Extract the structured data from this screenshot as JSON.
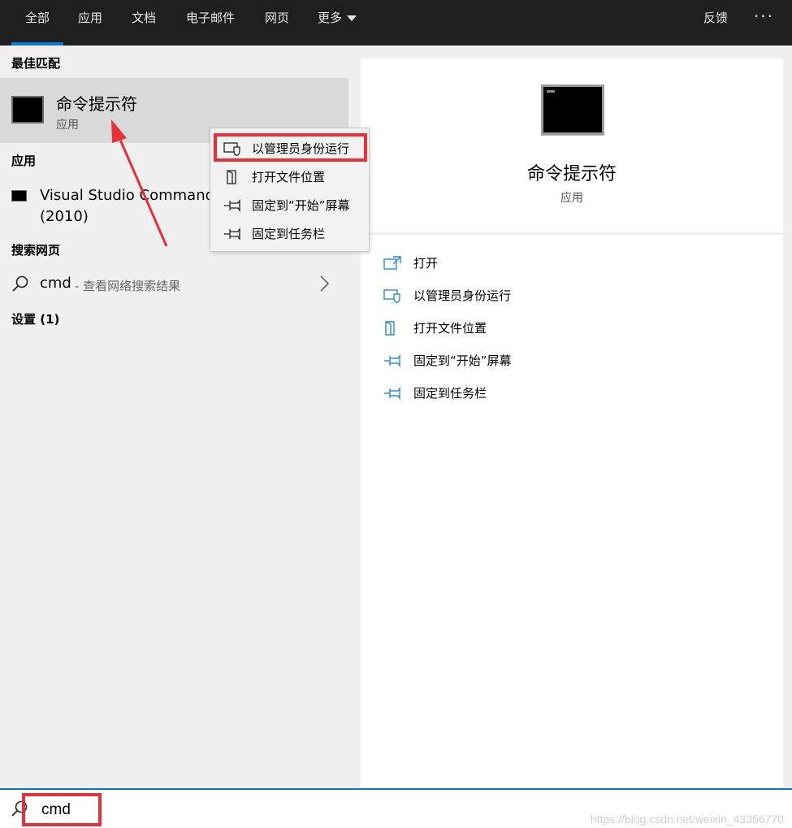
{
  "topbar": {
    "tabs": [
      {
        "label": "全部"
      },
      {
        "label": "应用"
      },
      {
        "label": "文档"
      },
      {
        "label": "电子邮件"
      },
      {
        "label": "网页"
      },
      {
        "label": "更多"
      }
    ],
    "feedback_label": "反馈",
    "more_options_label": "···"
  },
  "left": {
    "best_match_heading": "最佳匹配",
    "best_match": {
      "title": "命令提示符",
      "subtitle": "应用"
    },
    "apps_heading": "应用",
    "apps": [
      {
        "label": "Visual Studio Command\n(2010)"
      }
    ],
    "web_heading": "搜索网页",
    "web_result": {
      "query": "cmd",
      "hint": "- 查看网络搜索结果"
    },
    "settings_heading": "设置 (1)"
  },
  "context_menu": {
    "items": [
      {
        "label": "以管理员身份运行",
        "icon": "shield-icon"
      },
      {
        "label": "打开文件位置",
        "icon": "folder-icon"
      },
      {
        "label": "固定到“开始”屏幕",
        "icon": "pin-icon"
      },
      {
        "label": "固定到任务栏",
        "icon": "pin-icon"
      }
    ]
  },
  "preview": {
    "title": "命令提示符",
    "subtitle": "应用",
    "actions": [
      {
        "label": "打开",
        "icon": "open-icon"
      },
      {
        "label": "以管理员身份运行",
        "icon": "shield-icon"
      },
      {
        "label": "打开文件位置",
        "icon": "folder-icon"
      },
      {
        "label": "固定到“开始”屏幕",
        "icon": "pin-icon"
      },
      {
        "label": "固定到任务栏",
        "icon": "pin-icon"
      }
    ]
  },
  "search": {
    "value": "cmd"
  },
  "watermark": "https://blog.csdn.net/weixin_43356770",
  "colors": {
    "accent": "#0078d7",
    "highlight": "#e8303a",
    "topbar": "#1f1f1f",
    "action_icon": "#2a8ccf"
  }
}
